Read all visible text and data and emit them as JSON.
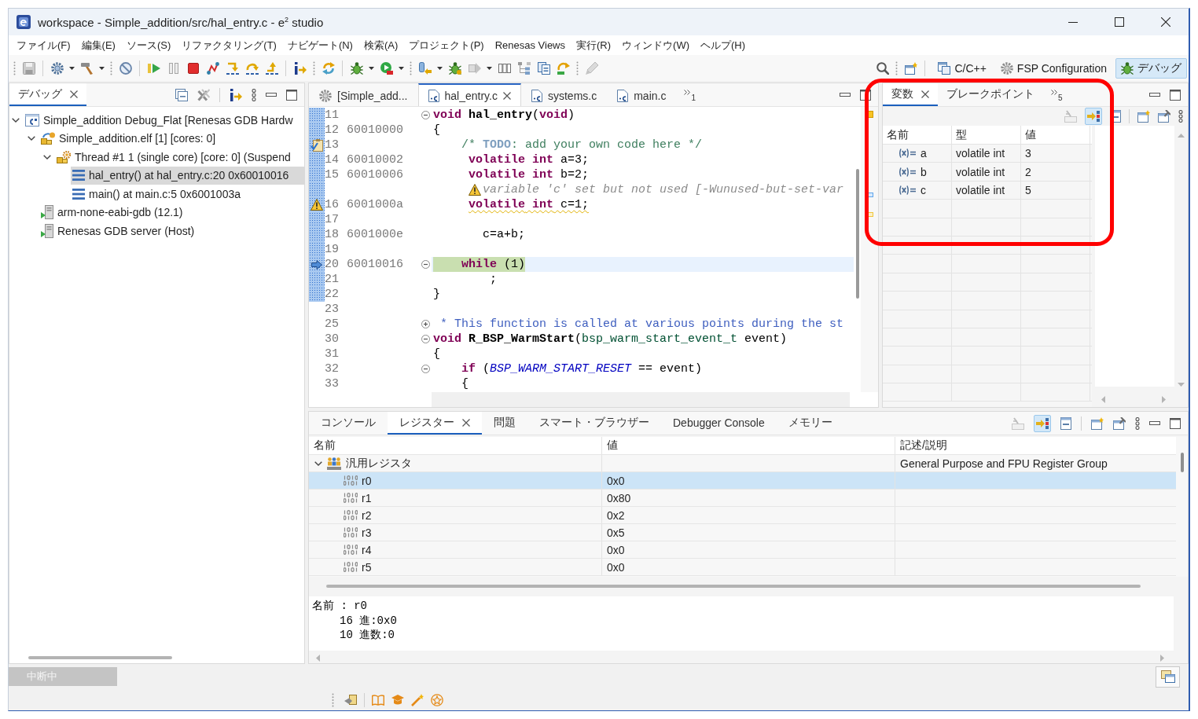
{
  "window": {
    "title": "workspace - Simple_addition/src/hal_entry.c - e$^{2}$ studio"
  },
  "menu": [
    "ファイル(F)",
    "編集(E)",
    "ソース(S)",
    "リファクタリング(T)",
    "ナビゲート(N)",
    "検索(A)",
    "プロジェクト(P)",
    "Renesas Views",
    "実行(R)",
    "ウィンドウ(W)",
    "ヘルプ(H)"
  ],
  "perspectives": [
    {
      "label": "C/C++",
      "kind": "c-cpp",
      "selected": false
    },
    {
      "label": "FSP Configuration",
      "kind": "fsp",
      "selected": false
    },
    {
      "label": "デバッグ",
      "kind": "debug",
      "selected": true
    }
  ],
  "debug_view": {
    "tabs": [
      {
        "label": "デバッグ",
        "selected": true
      }
    ],
    "tree": [
      {
        "label": "Simple_addition Debug_Flat [Renesas GDB Hardw",
        "kind": "launch",
        "expanded": true,
        "selected": false,
        "children": [
          {
            "label": "Simple_addition.elf [1] [cores: 0]",
            "kind": "process",
            "expanded": true,
            "selected": false,
            "children": [
              {
                "label": "Thread #1 1 (single core) [core: 0] (Suspend",
                "kind": "thread",
                "expanded": true,
                "selected": false,
                "children": [
                  {
                    "label": "hal_entry() at hal_entry.c:20 0x60010016",
                    "kind": "frame",
                    "selected": true
                  },
                  {
                    "label": "main() at main.c:5 0x6001003a",
                    "kind": "frame",
                    "selected": false
                  }
                ]
              }
            ]
          },
          {
            "label": "arm-none-eabi-gdb (12.1)",
            "kind": "tool",
            "selected": false
          },
          {
            "label": "Renesas GDB server (Host)",
            "kind": "tool",
            "selected": false
          }
        ]
      }
    ]
  },
  "editor": {
    "tabs": [
      {
        "label": "[Simple_add...",
        "kind": "launch-config",
        "selected": false
      },
      {
        "label": "hal_entry.c",
        "kind": "c-file",
        "selected": true
      },
      {
        "label": "systems.c",
        "kind": "c-file",
        "selected": false
      },
      {
        "label": "main.c",
        "kind": "c-file",
        "selected": false
      }
    ],
    "hidden_tabs": "1",
    "lines": [
      {
        "kind": "code",
        "number": "11",
        "in_range": true,
        "expanded": true,
        "tokens": [
          {
            "text": "void",
            "kind": "keyword"
          },
          {
            "text": " hal_entry",
            "kind": "function"
          },
          {
            "text": "(",
            "kind": "plain"
          },
          {
            "text": "void",
            "kind": "keyword"
          },
          {
            "text": ")",
            "kind": "plain"
          }
        ]
      },
      {
        "kind": "code",
        "number": "12",
        "address": "60010000",
        "in_range": true,
        "tokens": [
          {
            "text": "{",
            "kind": "plain"
          }
        ]
      },
      {
        "kind": "code",
        "number": "13",
        "in_range": true,
        "marker": {
          "kind": "task"
        },
        "tokens": [
          {
            "text": "    /* ",
            "kind": "comment"
          },
          {
            "text": "TODO",
            "kind": "task-tag"
          },
          {
            "text": ": add your own code here */",
            "kind": "comment"
          }
        ]
      },
      {
        "kind": "code",
        "number": "14",
        "address": "60010002",
        "in_range": true,
        "tokens": [
          {
            "text": "     volatile",
            "kind": "keyword"
          },
          {
            "text": " int",
            "kind": "keyword"
          },
          {
            "text": " a=3;",
            "kind": "plain"
          }
        ]
      },
      {
        "kind": "code",
        "number": "15",
        "address": "60010006",
        "in_range": true,
        "tokens": [
          {
            "text": "     volatile",
            "kind": "keyword"
          },
          {
            "text": " int",
            "kind": "keyword"
          },
          {
            "text": " b=2;",
            "kind": "plain"
          }
        ]
      },
      {
        "kind": "annotation",
        "text": "variable 'c' set but not used [-Wunused-but-set-var",
        "in_range": true
      },
      {
        "kind": "code",
        "number": "16",
        "address": "6001000a",
        "in_range": true,
        "marker": {
          "kind": "warning"
        },
        "tokens": [
          {
            "text": "     volatile",
            "kind": "keyword"
          },
          {
            "text": " int",
            "kind": "keyword"
          },
          {
            "text": " c=1;",
            "kind": "plain"
          }
        ]
      },
      {
        "kind": "code",
        "number": "17",
        "in_range": true
      },
      {
        "kind": "code",
        "number": "18",
        "address": "6001000e",
        "in_range": true,
        "tokens": [
          {
            "text": "       c=a+b;",
            "kind": "plain"
          }
        ]
      },
      {
        "kind": "code",
        "number": "19",
        "in_range": true
      },
      {
        "kind": "code",
        "number": "20",
        "address": "60010016",
        "in_range": true,
        "marker": {
          "kind": "instruction-pointer"
        },
        "expanded": true,
        "tokens": [
          {
            "text": "    while",
            "kind": "keyword"
          },
          {
            "text": " (1)",
            "kind": "plain"
          }
        ]
      },
      {
        "kind": "code",
        "number": "21",
        "in_range": true,
        "tokens": [
          {
            "text": "        ;",
            "kind": "plain"
          }
        ]
      },
      {
        "kind": "code",
        "number": "22",
        "in_range": true,
        "tokens": [
          {
            "text": "}",
            "kind": "plain"
          }
        ]
      },
      {
        "kind": "code",
        "number": "23",
        "in_range": false
      },
      {
        "kind": "code",
        "number": "25",
        "in_range": false,
        "expanded": false,
        "tokens": [
          {
            "text": " * This function is called at various points during the st",
            "kind": "doc"
          }
        ]
      },
      {
        "kind": "code",
        "number": "30",
        "in_range": false,
        "expanded": true,
        "tokens": [
          {
            "text": "void",
            "kind": "keyword"
          },
          {
            "text": " R_BSP_WarmStart",
            "kind": "function"
          },
          {
            "text": "(",
            "kind": "plain"
          },
          {
            "text": "bsp_warm_start_event_t",
            "kind": "type"
          },
          {
            "text": " event)",
            "kind": "plain"
          }
        ]
      },
      {
        "kind": "code",
        "number": "31",
        "in_range": false,
        "tokens": [
          {
            "text": "{",
            "kind": "plain"
          }
        ]
      },
      {
        "kind": "code",
        "number": "32",
        "in_range": false,
        "expanded": true,
        "tokens": [
          {
            "text": "    if",
            "kind": "keyword"
          },
          {
            "text": " (",
            "kind": "plain"
          },
          {
            "text": "BSP_WARM_START_RESET",
            "kind": "macro"
          },
          {
            "text": " == event)",
            "kind": "plain"
          }
        ]
      },
      {
        "kind": "code",
        "number": "33",
        "in_range": false,
        "tokens": [
          {
            "text": "    {",
            "kind": "plain"
          }
        ]
      }
    ]
  },
  "variables_view": {
    "tabs": [
      {
        "label": "変数",
        "selected": true
      },
      {
        "label": "ブレークポイント",
        "selected": false
      }
    ],
    "hidden_tabs": "5",
    "toggle": {
      "on": true
    },
    "columns": [
      "名前",
      "型",
      "値"
    ],
    "rows": [
      {
        "name": "a",
        "type": "volatile int",
        "value": "3"
      },
      {
        "name": "b",
        "type": "volatile int",
        "value": "2"
      },
      {
        "name": "c",
        "type": "volatile int",
        "value": "5"
      }
    ]
  },
  "registers_view": {
    "tabs": [
      {
        "label": "コンソール",
        "selected": false
      },
      {
        "label": "レジスター",
        "selected": true
      },
      {
        "label": "問題",
        "selected": false
      },
      {
        "label": "スマート・ブラウザー",
        "selected": false
      },
      {
        "label": "Debugger Console",
        "selected": false
      },
      {
        "label": "メモリー",
        "selected": false
      }
    ],
    "toggle": {
      "on": true
    },
    "columns": [
      "名前",
      "値",
      "記述/説明"
    ],
    "groups": [
      {
        "name": "汎用レジスタ",
        "description": "General Purpose and FPU Register Group",
        "expanded": true,
        "selected": false,
        "registers": [
          {
            "name": "r0",
            "value": "0x0",
            "selected": true
          },
          {
            "name": "r1",
            "value": "0x80",
            "selected": false
          },
          {
            "name": "r2",
            "value": "0x2",
            "selected": false
          },
          {
            "name": "r3",
            "value": "0x5",
            "selected": false
          },
          {
            "name": "r4",
            "value": "0x0",
            "selected": false
          },
          {
            "name": "r5",
            "value": "0x0",
            "selected": false
          }
        ]
      }
    ],
    "detail": {
      "title": "名前 : r0",
      "values": [
        "16 進:0x0",
        "10 進数:0"
      ]
    }
  },
  "status": {
    "text": "中断中"
  }
}
